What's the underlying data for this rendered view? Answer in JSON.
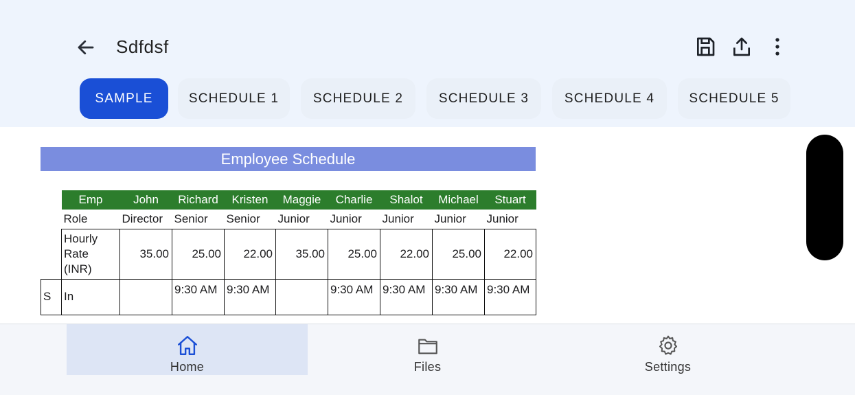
{
  "header": {
    "title": "Sdfdsf",
    "icons": [
      "back-arrow-icon",
      "save-icon",
      "share-icon",
      "more-vert-icon"
    ]
  },
  "tabs": [
    {
      "label": "SAMPLE",
      "active": true
    },
    {
      "label": "SCHEDULE 1",
      "active": false
    },
    {
      "label": "SCHEDULE 2",
      "active": false
    },
    {
      "label": "SCHEDULE 3",
      "active": false
    },
    {
      "label": "SCHEDULE 4",
      "active": false
    },
    {
      "label": "SCHEDULE 5",
      "active": false
    }
  ],
  "sheet": {
    "title": "Employee Schedule",
    "header_row": [
      "Emp",
      "John",
      "Richard",
      "Kristen",
      "Maggie",
      "Charlie",
      "Shalot",
      "Michael",
      "Stuart"
    ],
    "role_row": [
      "Role",
      "Director",
      "Senior",
      "Senior",
      "Junior",
      "Junior",
      "Junior",
      "Junior",
      "Junior"
    ],
    "rate_label": "Hourly Rate (INR)",
    "rates": [
      "35.00",
      "25.00",
      "22.00",
      "35.00",
      "25.00",
      "22.00",
      "25.00",
      "22.00"
    ],
    "in_row": {
      "day": "S",
      "label": "In",
      "values": [
        "",
        "9:30 AM",
        "9:30 AM",
        "",
        "9:30 AM",
        "9:30 AM",
        "9:30 AM",
        "9:30 AM"
      ]
    }
  },
  "bottom_nav": [
    {
      "label": "Home",
      "icon": "home-icon",
      "active": true
    },
    {
      "label": "Files",
      "icon": "folder-icon",
      "active": false
    },
    {
      "label": "Settings",
      "icon": "gear-icon",
      "active": false
    }
  ],
  "colors": {
    "accent": "#1a4fd6",
    "sheet_title_bg": "#7a8ddf",
    "table_header_bg": "#2c7d2c",
    "header_bg": "#eef4fd"
  }
}
